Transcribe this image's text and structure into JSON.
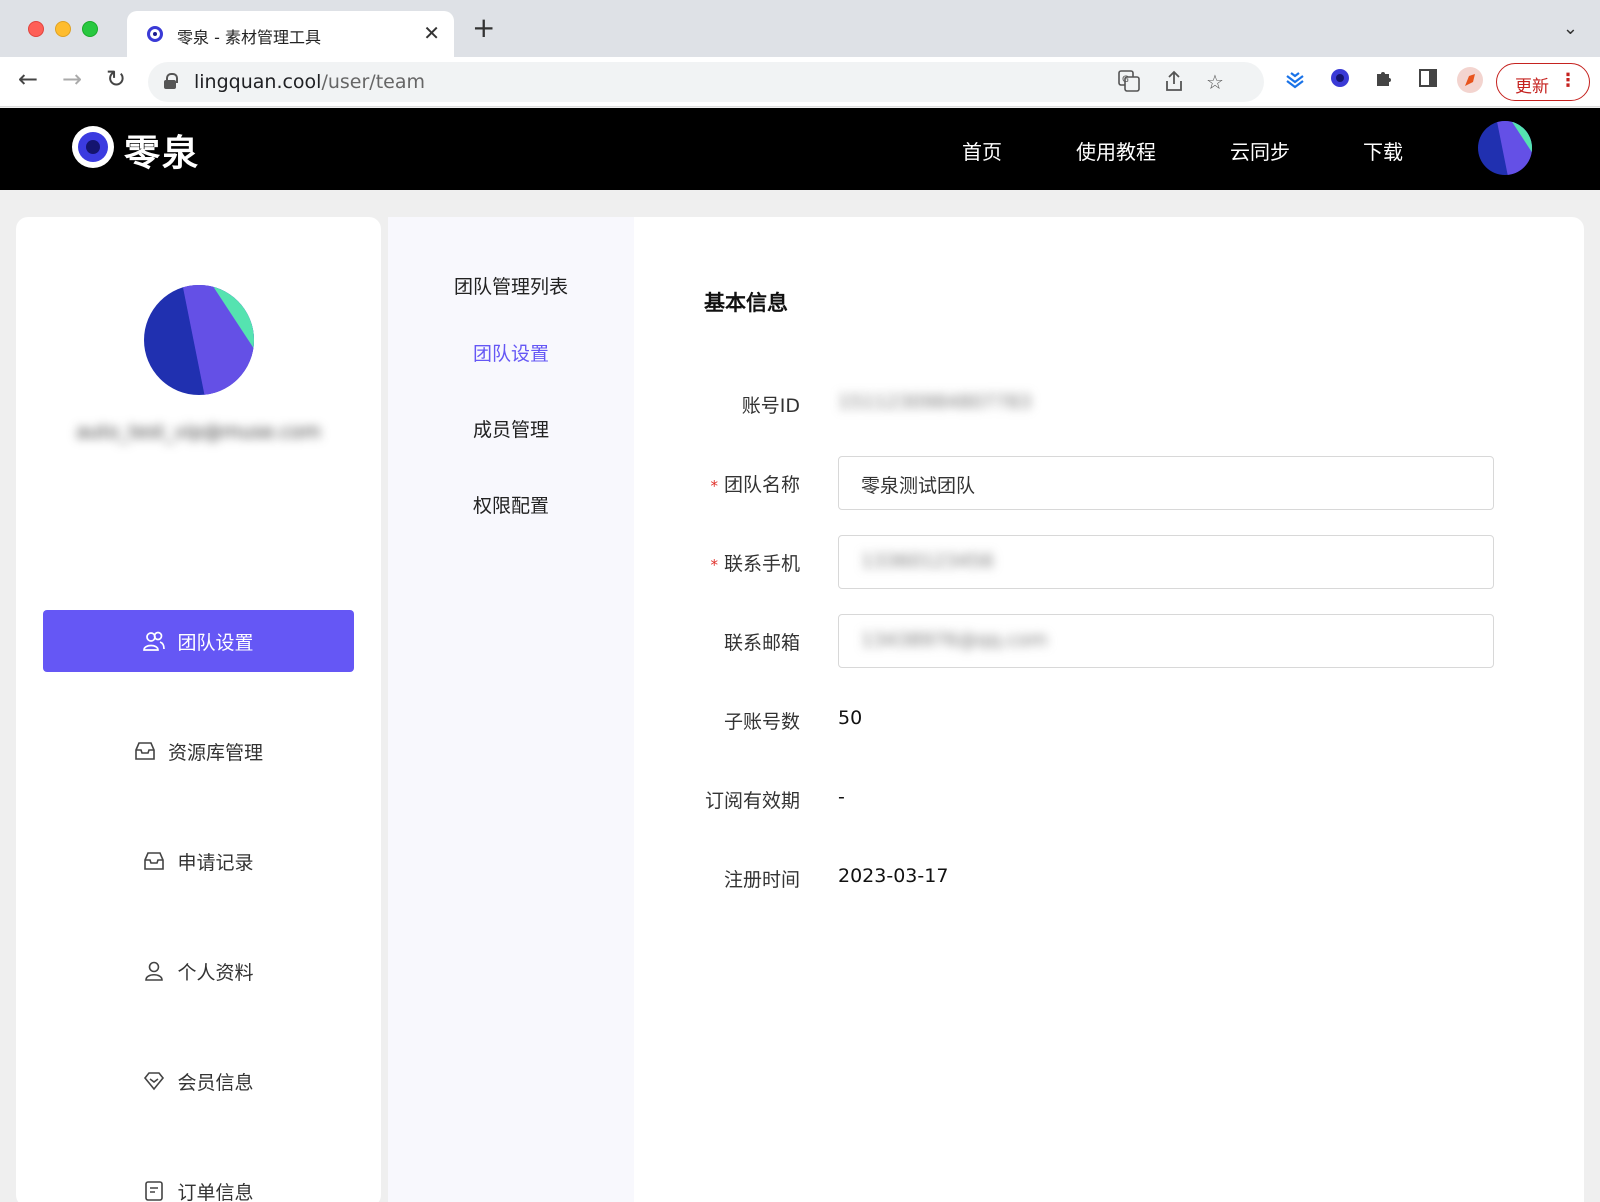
{
  "browser": {
    "tab_title": "零泉 - 素材管理工具",
    "url_host": "lingquan.cool",
    "url_path": "/user/team",
    "update_label": "更新"
  },
  "header": {
    "logo_text": "零泉",
    "nav": [
      "首页",
      "使用教程",
      "云同步",
      "下载"
    ]
  },
  "profile": {
    "email": "auto_test_vip@muse.com"
  },
  "sidebar": {
    "items": [
      {
        "label": "团队设置",
        "icon": "team-icon",
        "active": true
      },
      {
        "label": "资源库管理",
        "icon": "inbox-icon"
      },
      {
        "label": "申请记录",
        "icon": "inbox-icon"
      },
      {
        "label": "个人资料",
        "icon": "user-icon"
      },
      {
        "label": "会员信息",
        "icon": "diamond-icon"
      },
      {
        "label": "订单信息",
        "icon": "document-icon"
      }
    ]
  },
  "subnav": {
    "heading": "团队管理列表",
    "items": [
      "团队设置",
      "成员管理",
      "权限配置"
    ],
    "active": "团队设置"
  },
  "form": {
    "title": "基本信息",
    "account_id_label": "账号ID",
    "account_id_value": "1511230984807783",
    "team_name_label": "团队名称",
    "team_name_value": "零泉测试团队",
    "phone_label": "联系手机",
    "phone_value": "13360123456",
    "email_label": "联系邮箱",
    "email_value": "13438976@qq.com",
    "sub_accounts_label": "子账号数",
    "sub_accounts_value": "50",
    "subscription_label": "订阅有效期",
    "subscription_value": "-",
    "register_label": "注册时间",
    "register_value": "2023-03-17"
  },
  "colors": {
    "accent": "#6557f5",
    "required": "#e0302a",
    "header_bg": "#000000"
  }
}
